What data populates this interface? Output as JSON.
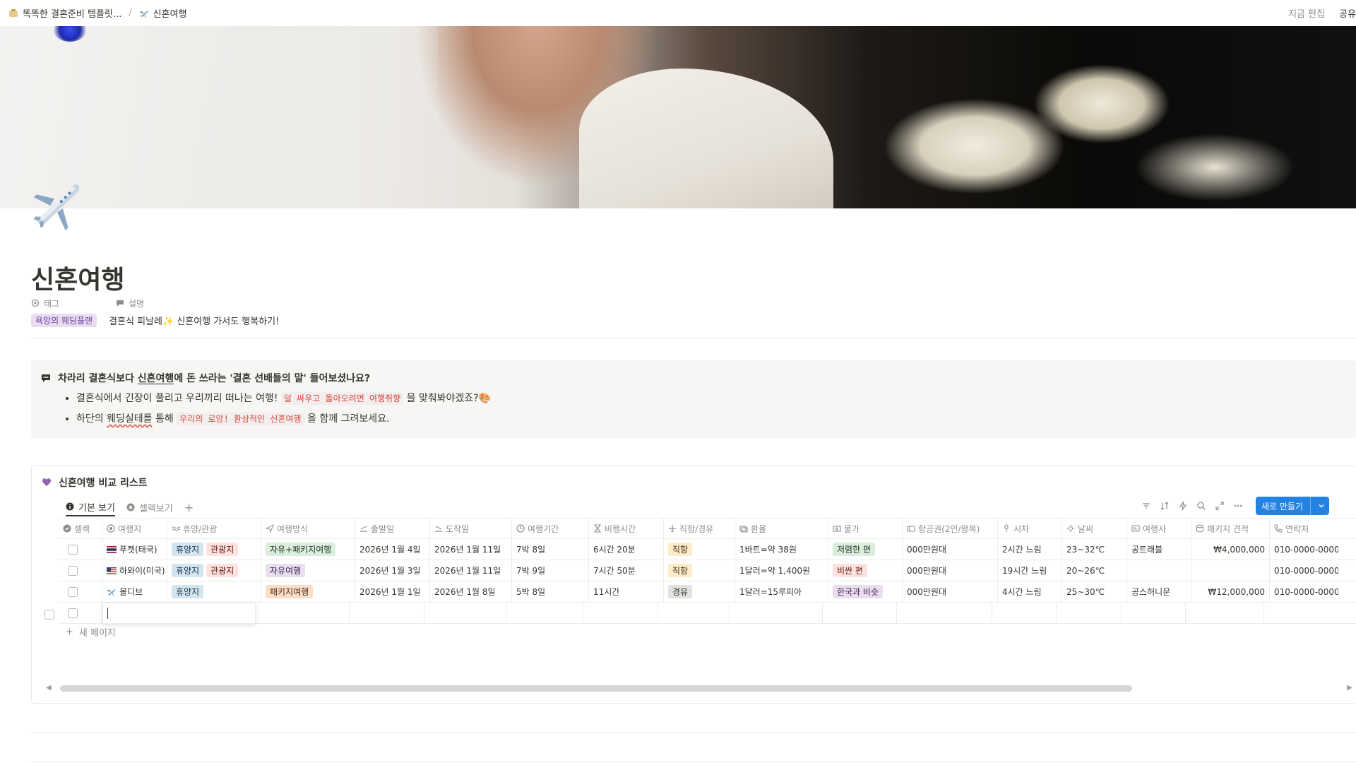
{
  "breadcrumb": {
    "parent": "똑똑한 결혼준비 템플릿...",
    "separator": "/",
    "current": "신혼여행"
  },
  "topbar": {
    "edited": "지금 편집",
    "share": "공유"
  },
  "page": {
    "title": "신혼여행",
    "properties": {
      "tag_label": "태그",
      "desc_label": "설명",
      "tag_value": "욕망의 웨딩플랜",
      "desc_value": "결혼식 피날레✨ 신혼여행 가서도 행복하기!"
    }
  },
  "callout": {
    "heading_pre": "차라리 결혼식보다 ",
    "heading_link": "신혼여행",
    "heading_post": "에 돈 쓰라는 '결혼 선배들의 말' 들어보셨나요?",
    "item1_pre": "결혼식에서 긴장이 풀리고 우리끼리 떠나는 여행!",
    "item1_code": "덜 싸우고 돌아오려면 여행취향",
    "item1_post": "을 맞춰봐야겠죠?🎨",
    "item2_pre": "하단의 ",
    "item2_underline": "웨딩실테를",
    "item2_mid": " 통해",
    "item2_code": "우리의 로망! 환상적인 신혼여행",
    "item2_post": "을 함께 그려보세요."
  },
  "database": {
    "title": "신혼여행 비교 리스트",
    "views": [
      "기본 보기",
      "셀렉보기"
    ],
    "new_button": "새로 만들기",
    "new_page": "새 페이지",
    "columns": [
      "셀렉",
      "여행지",
      "휴양/관광",
      "여행방식",
      "출발일",
      "도착일",
      "여행기간",
      "비행시간",
      "직항/경유",
      "환율",
      "물가",
      "항공권(2인/왕복)",
      "시차",
      "날씨",
      "여행사",
      "패키지 견적",
      "연락처"
    ],
    "rows": [
      {
        "dest": "푸켓(태국)",
        "type1": "휴양지",
        "type2": "관광지",
        "style": "자유+패키지여행",
        "depart": "2026년 1월 4일",
        "arrive": "2026년 1월 11일",
        "duration": "7박 8일",
        "flight": "6시간 20분",
        "direct": "직항",
        "rate": "1바트=약 38원",
        "price": "저렴한 편",
        "ticket": "000만원대",
        "diff": "2시간 느림",
        "weather": "23~32℃",
        "agency": "공트래블",
        "quote": "₩4,000,000",
        "phone": "010-0000-0000"
      },
      {
        "dest": "하와이(미국)",
        "type1": "휴양지",
        "type2": "관광지",
        "style": "자유여행",
        "depart": "2026년 1월 3일",
        "arrive": "2026년 1월 11일",
        "duration": "7박 9일",
        "flight": "7시간 50분",
        "direct": "직항",
        "rate": "1달러=약 1,400원",
        "price": "비싼 편",
        "ticket": "000만원대",
        "diff": "19시간 느림",
        "weather": "20~26℃",
        "agency": "",
        "quote": "",
        "phone": "010-0000-0000"
      },
      {
        "dest": "몰디브",
        "type1": "휴양지",
        "type2": "",
        "style": "패키지여행",
        "depart": "2026년 1월 1일",
        "arrive": "2026년 1월 8일",
        "duration": "5박 8일",
        "flight": "11시간",
        "direct": "경유",
        "rate": "1달러=15루피아",
        "price": "한국과 비슷",
        "ticket": "000만원대",
        "diff": "4시간 느림",
        "weather": "25~30℃",
        "agency": "공스허니문",
        "quote": "₩12,000,000",
        "phone": "010-0000-0000"
      }
    ]
  }
}
